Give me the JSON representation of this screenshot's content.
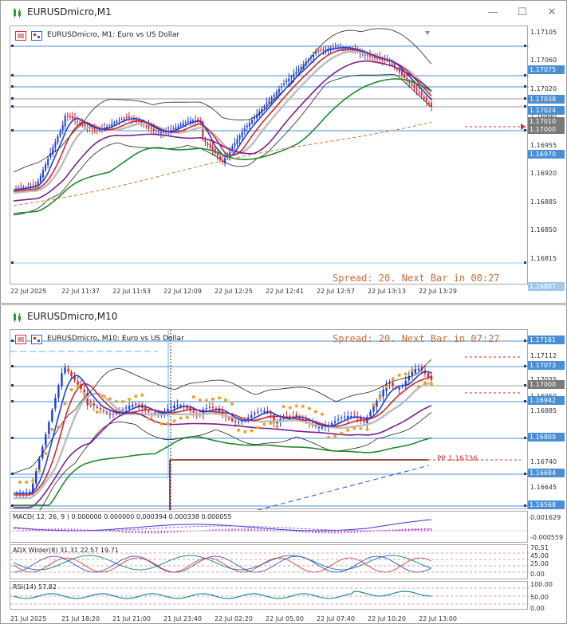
{
  "top": {
    "title": "EURUSDmicro,M1",
    "symbol_label": "EURUSDmicro, M1:  Euro vs US Dollar",
    "spread_text": "Spread: 20. Next Bar in 00:27",
    "price_labels": [
      "1.17105",
      "1.17060",
      "1.17020",
      "1.16990",
      "1.16955",
      "1.16920",
      "1.16885",
      "1.16850",
      "1.16815"
    ],
    "price_tags": [
      {
        "text": "1.17075",
        "color": "#4a8fd6"
      },
      {
        "text": "1.17038",
        "color": "#4a8fd6"
      },
      {
        "text": "1.17024",
        "color": "#4a8fd6"
      },
      {
        "text": "1.17010",
        "color": "#7a7a7a"
      },
      {
        "text": "1.17000",
        "color": "#7a7a7a"
      },
      {
        "text": "1.16970",
        "color": "#4a8fd6"
      },
      {
        "text": "1.16807",
        "color": "#9ec8ec"
      }
    ],
    "time_labels": [
      "22 Jul 2025",
      "22 Jul 11:37",
      "22 Jul 11:53",
      "22 Jul 12:09",
      "22 Jul 12:25",
      "22 Jul 12:41",
      "22 Jul 12:57",
      "22 Jul 13:13",
      "22 Jul 13:29"
    ]
  },
  "bottom": {
    "title": "EURUSDmicro,M10",
    "symbol_label": "EURUSDmicro, M10:  Euro vs US Dollar",
    "spread_text": "Spread: 20. Next Bar in 07:27",
    "pp_text": "PP 1.16736",
    "price_labels": [
      "1.17112",
      "1.17025",
      "1.16950",
      "1.16885",
      "1.16740",
      "1.16645"
    ],
    "price_tags": [
      {
        "text": "1.17161",
        "color": "#4a8fd6"
      },
      {
        "text": "1.17073",
        "color": "#4a8fd6"
      },
      {
        "text": "1.17000",
        "color": "#7a7a7a"
      },
      {
        "text": "1.16942",
        "color": "#4a8fd6"
      },
      {
        "text": "1.16809",
        "color": "#4a8fd6"
      },
      {
        "text": "1.16684",
        "color": "#4a8fd6"
      },
      {
        "text": "1.16568",
        "color": "#4a8fd6"
      }
    ],
    "macd_label": "MACD( 12, 26, 9 ) 0.000000 0.000000 0.000394 0.000338 0.000055",
    "macd_scale": [
      "0.001629",
      "-0.000559"
    ],
    "adx_label": "ADX Wilder(8) 31.31 22.57 19.71",
    "adx_scale": [
      "70.51",
      "45.00",
      "25.00",
      "0.00"
    ],
    "rsi_label": "RSI(14) 57.82",
    "rsi_scale": [
      "100.00",
      "50.00",
      "0.00"
    ],
    "time_labels": [
      "21 Jul 2025",
      "21 Jul 18:20",
      "21 Jul 21:00",
      "21 Jul 23:40",
      "22 Jul 02:20",
      "22 Jul 05:00",
      "22 Jul 07:40",
      "22 Jul 10:20",
      "22 Jul 13:00"
    ]
  },
  "colors": {
    "bull": "#1f3fd1",
    "bear": "#d4242c",
    "gray_ma": "#bdbdbd",
    "purple_ma": "#7a1f8c",
    "green_ma": "#1f8a2a",
    "orange_ma": "#e0702a",
    "psar": "#f0a020",
    "pp_line": "#7a1010"
  }
}
